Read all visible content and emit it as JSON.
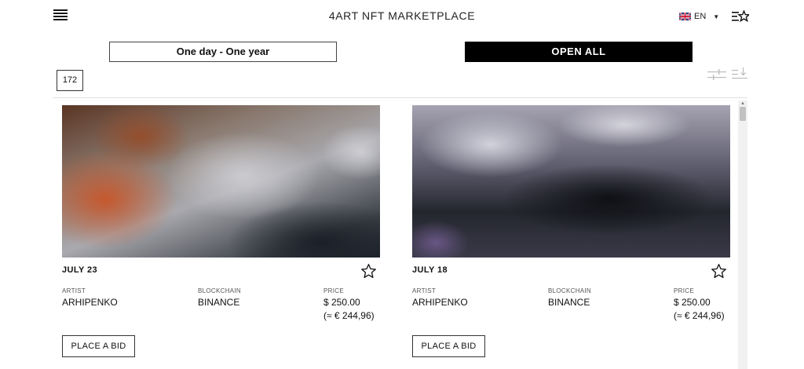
{
  "header": {
    "title": "4ART NFT MARKETPLACE",
    "menu_icon": "hamburger-menu-icon",
    "language": "EN",
    "flag_icon": "uk-flag-icon",
    "favorites_icon": "favorites-list-icon"
  },
  "toolbar": {
    "range_label": "One day - One year",
    "open_all_label": "OPEN ALL",
    "count": "172",
    "filter_icon": "sliders-icon",
    "sort_icon": "sort-icon"
  },
  "cards": [
    {
      "date": "JULY 23",
      "artist_label": "ARTIST",
      "artist": "ARHIPENKO",
      "blockchain_label": "BLOCKCHAIN",
      "blockchain": "BINANCE",
      "price_label": "PRICE",
      "price": "$ 250.00",
      "price_eur": "(≈ € 244,96)",
      "bid_label": "PLACE A BID"
    },
    {
      "date": "JULY 18",
      "artist_label": "ARTIST",
      "artist": "ARHIPENKO",
      "blockchain_label": "BLOCKCHAIN",
      "blockchain": "BINANCE",
      "price_label": "PRICE",
      "price": "$ 250.00",
      "price_eur": "(≈ € 244,96)",
      "bid_label": "PLACE A BID"
    }
  ],
  "colors": {
    "accent": "#000000",
    "text": "#111111",
    "border": "#444444"
  }
}
